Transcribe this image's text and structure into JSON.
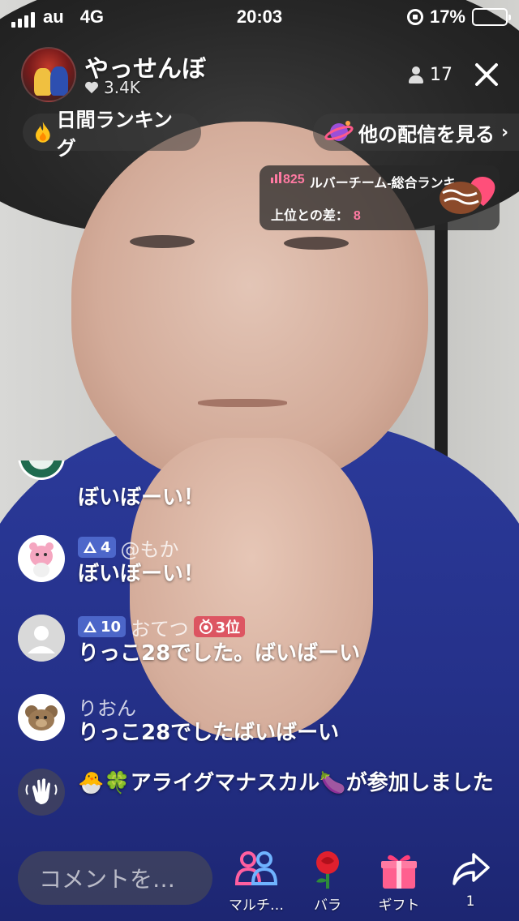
{
  "status_bar": {
    "carrier": "au",
    "network": "4G",
    "time": "20:03",
    "battery": "17%",
    "battery_level": 0.17
  },
  "header": {
    "streamer_name": "やっせんぼ",
    "likes": "3.4K",
    "viewer_count": "17"
  },
  "pills": {
    "ranking_label": "日間ランキング",
    "other_streams_label": "他の配信を見る",
    "chevron": "›"
  },
  "team_rank": {
    "score": "825",
    "team_text": "ルバーチーム-総合ランキ",
    "diff_label": "上位との差：",
    "diff_value": "8"
  },
  "chat": [
    {
      "avatar": "starbucks-avatar",
      "name": "",
      "level": "",
      "rank": "",
      "text": "ぼいぼーい！"
    },
    {
      "avatar": "pink-character-avatar",
      "name": "@もか",
      "level": "4",
      "rank": "",
      "text": "ぼいぼーい！"
    },
    {
      "avatar": "default-avatar",
      "name": "おてつ",
      "level": "10",
      "rank": "3位",
      "text": "りっこ28でした。ばいばーい"
    },
    {
      "avatar": "bear-avatar",
      "name": "りおん",
      "level": "",
      "rank": "",
      "text": "りっこ28でしたばいばーい"
    },
    {
      "avatar": "wave-hand-icon",
      "name": "",
      "level": "",
      "rank": "",
      "text": "🐣🍀アライグマナスカル🍆が参加しました"
    }
  ],
  "bottom_bar": {
    "comment_placeholder": "コメントを…",
    "multi_label": "マルチ…",
    "rose_label": "バラ",
    "gift_label": "ギフト",
    "share_count": "1"
  },
  "colors": {
    "accent_pink": "#ff7aa2",
    "level_badge": "#5a78dc",
    "rank_badge": "#dc3c50",
    "battery": "#f4d000"
  }
}
